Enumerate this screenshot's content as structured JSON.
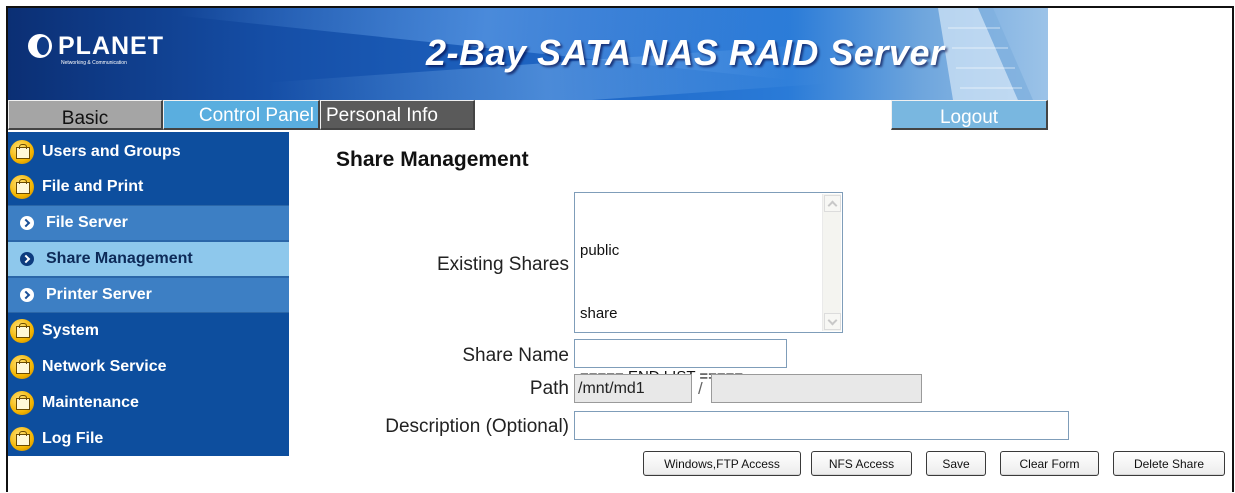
{
  "header": {
    "brand": "PLANET",
    "brand_tagline": "Networking & Communication",
    "title": "2-Bay SATA NAS RAID Server"
  },
  "menu": {
    "basic": "Basic",
    "control_panel": "Control Panel",
    "personal_info": "Personal Info",
    "logout": "Logout"
  },
  "sidebar": {
    "items": [
      {
        "label": "Users and Groups",
        "type": "folder"
      },
      {
        "label": "File and Print",
        "type": "folder"
      },
      {
        "label": "File Server",
        "type": "sub"
      },
      {
        "label": "Share Management",
        "type": "sub",
        "active": true
      },
      {
        "label": "Printer Server",
        "type": "sub"
      },
      {
        "label": "System",
        "type": "folder"
      },
      {
        "label": "Network Service",
        "type": "folder"
      },
      {
        "label": "Maintenance",
        "type": "folder"
      },
      {
        "label": "Log File",
        "type": "folder"
      }
    ]
  },
  "main": {
    "title": "Share Management",
    "existing_shares_label": "Existing Shares",
    "existing_shares": [
      "public",
      "share",
      "===== END LIST ====="
    ],
    "share_name_label": "Share Name",
    "share_name_value": "",
    "path_label": "Path",
    "path_prefix": "/mnt/md1",
    "path_separator": "/",
    "path_value": "",
    "description_label": "Description (Optional)",
    "description_value": ""
  },
  "buttons": {
    "windows_ftp": "Windows,FTP Access",
    "nfs": "NFS Access",
    "save": "Save",
    "clear_form": "Clear Form",
    "delete_share": "Delete Share"
  },
  "colors": {
    "sidebar_bg": "#0d4e9e",
    "sub_item_bg": "#3d7fc4",
    "active_item_bg": "#8ec8ec",
    "control_panel_tab": "#5aaedf",
    "personal_info_tab": "#5a5a5a",
    "basic_tab": "#a5a5a5"
  }
}
